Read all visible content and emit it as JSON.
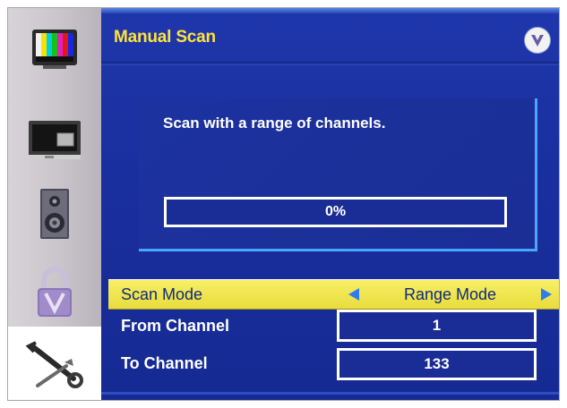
{
  "header": {
    "title": "Manual Scan",
    "brand_icon": "v-logo-icon"
  },
  "sidebar": {
    "items": [
      {
        "name": "picture-icon",
        "active": false
      },
      {
        "name": "tv-input-icon",
        "active": false
      },
      {
        "name": "speaker-icon",
        "active": false
      },
      {
        "name": "parental-lock-icon",
        "active": false
      },
      {
        "name": "setup-tools-icon",
        "active": true
      }
    ]
  },
  "scan": {
    "message": "Scan with a range of channels.",
    "progress_label": "0%",
    "progress_value": 0
  },
  "settings": {
    "scan_mode": {
      "label": "Scan Mode",
      "value": "Range Mode"
    },
    "from_channel": {
      "label": "From Channel",
      "value": "1"
    },
    "to_channel": {
      "label": "To Channel",
      "value": "133"
    }
  },
  "colors": {
    "background": "#1b2f9c",
    "title": "#ffe23a",
    "highlight": "#f2e64e",
    "arrow": "#2f7cf0",
    "panel_border": "#49a6ff"
  }
}
